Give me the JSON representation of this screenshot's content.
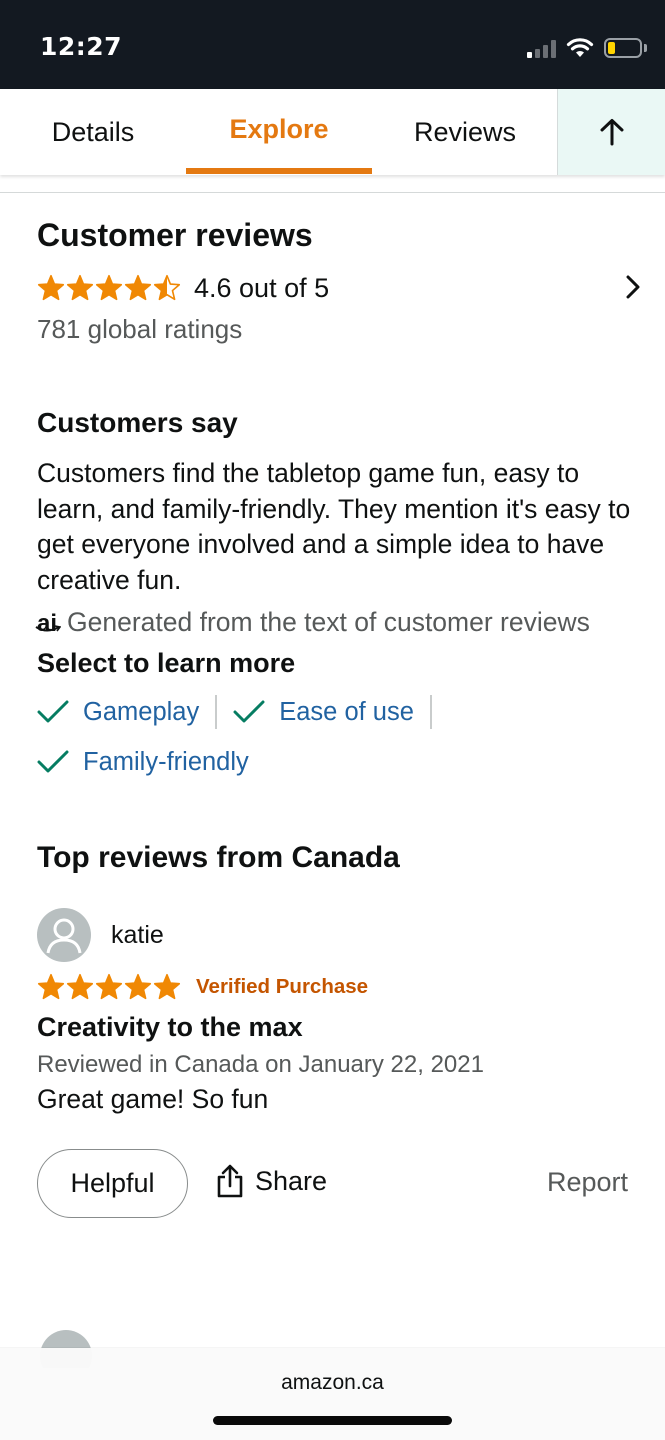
{
  "status_bar": {
    "time": "12:27"
  },
  "tabs": [
    {
      "label": "Details"
    },
    {
      "label": "Explore",
      "active": true
    },
    {
      "label": "Reviews"
    }
  ],
  "accent_color": "#e47911",
  "star_color": "#f08804",
  "link_color": "#2162a1",
  "customer_reviews": {
    "title": "Customer reviews",
    "rating": 4.6,
    "rating_text": "4.6 out of 5",
    "global_ratings": "781 global ratings"
  },
  "customers_say": {
    "title": "Customers say",
    "summary": "Customers find the tabletop game fun, easy to learn, and family-friendly. They mention it's easy to get everyone involved and a simple idea to have creative fun.",
    "ai_logo": "ai",
    "ai_note": "Generated from the text of customer reviews",
    "select_title": "Select to learn more",
    "aspects": [
      "Gameplay",
      "Ease of use",
      "Family-friendly"
    ]
  },
  "top_reviews": {
    "title": "Top reviews from Canada",
    "reviews": [
      {
        "reviewer": "katie",
        "stars": 5,
        "verified": "Verified Purchase",
        "title": "Creativity to the max",
        "meta": "Reviewed in Canada on January 22, 2021",
        "body": "Great game! So fun",
        "helpful_label": "Helpful",
        "share_label": "Share",
        "report_label": "Report"
      }
    ]
  },
  "bottom_bar": {
    "domain": "amazon.ca"
  }
}
